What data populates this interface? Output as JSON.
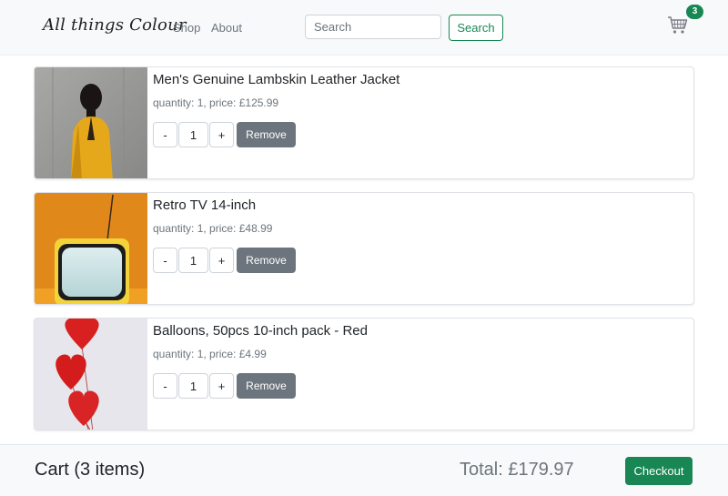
{
  "navbar": {
    "brand": "All things Colour",
    "links": [
      {
        "label": "Shop"
      },
      {
        "label": "About"
      }
    ],
    "search": {
      "placeholder": "Search",
      "value": "",
      "button_label": "Search"
    },
    "cart_badge_count": "3",
    "cart_icon": "shopping-cart-icon"
  },
  "items": [
    {
      "title": "Men's Genuine Lambskin Leather Jacket",
      "meta": "quantity: 1, price: £125.99",
      "quantity": "1",
      "minus_label": "-",
      "plus_label": "+",
      "remove_label": "Remove",
      "image": "man-in-yellow-jacket-photo"
    },
    {
      "title": "Retro TV 14-inch",
      "meta": "quantity: 1, price: £48.99",
      "quantity": "1",
      "minus_label": "-",
      "plus_label": "+",
      "remove_label": "Remove",
      "image": "retro-tv-photo"
    },
    {
      "title": "Balloons, 50pcs 10-inch pack - Red",
      "meta": "quantity: 1, price: £4.99",
      "quantity": "1",
      "minus_label": "-",
      "plus_label": "+",
      "remove_label": "Remove",
      "image": "red-heart-balloons-photo"
    }
  ],
  "footer": {
    "cart_count": "Cart (3 items)",
    "total": "Total: £179.97",
    "checkout_label": "Checkout"
  },
  "colors": {
    "accent": "#198754",
    "secondary": "#6c757d",
    "navbar_bg": "#f8f9fa"
  }
}
